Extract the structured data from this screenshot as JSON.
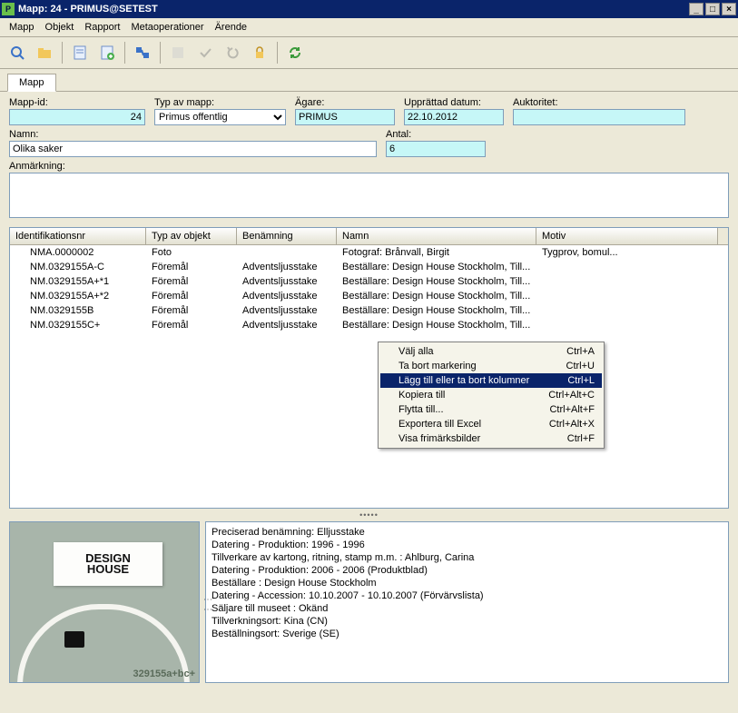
{
  "window": {
    "title": "Mapp: 24 - PRIMUS@SETEST"
  },
  "menu": {
    "items": [
      "Mapp",
      "Objekt",
      "Rapport",
      "Metaoperationer",
      "Ärende"
    ]
  },
  "tab": {
    "label": "Mapp"
  },
  "labels": {
    "mapp_id": "Mapp-id:",
    "typ": "Typ av mapp:",
    "agare": "Ägare:",
    "datum": "Upprättad datum:",
    "auktoritet": "Auktoritet:",
    "namn": "Namn:",
    "antal": "Antal:",
    "anmarkning": "Anmärkning:"
  },
  "values": {
    "mapp_id": "24",
    "typ": "Primus offentlig",
    "agare": "PRIMUS",
    "datum": "22.10.2012",
    "auktoritet": "",
    "namn": "Olika saker",
    "antal": "6",
    "anmarkning": ""
  },
  "columns": [
    "Identifikationsnr",
    "Typ av objekt",
    "Benämning",
    "Namn",
    "Motiv"
  ],
  "rows": [
    {
      "id": "NMA.0000002",
      "type": "Foto",
      "ben": "",
      "namn": "Fotograf: Brånvall, Birgit",
      "motiv": "Tygprov, bomul..."
    },
    {
      "id": "NM.0329155A-C",
      "type": "Föremål",
      "ben": "Adventsljusstake",
      "namn": "Beställare: Design House Stockholm, Till...",
      "motiv": ""
    },
    {
      "id": "NM.0329155A+*1",
      "type": "Föremål",
      "ben": "Adventsljusstake",
      "namn": "Beställare: Design House Stockholm, Till...",
      "motiv": ""
    },
    {
      "id": "NM.0329155A+*2",
      "type": "Föremål",
      "ben": "Adventsljusstake",
      "namn": "Beställare: Design House Stockholm, Till...",
      "motiv": ""
    },
    {
      "id": "NM.0329155B",
      "type": "Föremål",
      "ben": "Adventsljusstake",
      "namn": "Beställare: Design House Stockholm, Till...",
      "motiv": ""
    },
    {
      "id": "NM.0329155C+",
      "type": "Föremål",
      "ben": "Adventsljusstake",
      "namn": "Beställare: Design House Stockholm, Till...",
      "motiv": ""
    }
  ],
  "context_menu": [
    {
      "label": "Välj alla",
      "shortcut": "Ctrl+A",
      "sel": false
    },
    {
      "label": "Ta bort markering",
      "shortcut": "Ctrl+U",
      "sel": false
    },
    {
      "label": "Lägg till eller ta bort kolumner",
      "shortcut": "Ctrl+L",
      "sel": true
    },
    {
      "label": "Kopiera till",
      "shortcut": "Ctrl+Alt+C",
      "sel": false
    },
    {
      "label": "Flytta till...",
      "shortcut": "Ctrl+Alt+F",
      "sel": false
    },
    {
      "label": "Exportera till Excel",
      "shortcut": "Ctrl+Alt+X",
      "sel": false
    },
    {
      "label": "Visa frimärksbilder",
      "shortcut": "Ctrl+F",
      "sel": false
    }
  ],
  "thumb": {
    "logo1": "DESIGN",
    "logo2": "HOUSE",
    "caption": "329155a+bc+"
  },
  "detail_lines": [
    "Preciserad benämning: Elljusstake",
    "Datering - Produktion: 1996 - 1996",
    "Tillverkare av kartong, ritning, stamp m.m. : Ahlburg, Carina",
    "Datering - Produktion: 2006 - 2006  (Produktblad)",
    "Beställare : Design House Stockholm",
    "Datering - Accession: 10.10.2007 - 10.10.2007  (Förvärvslista)",
    "Säljare till museet : Okänd",
    "Tillverkningsort: Kina (CN)",
    "Beställningsort: Sverige (SE)"
  ]
}
